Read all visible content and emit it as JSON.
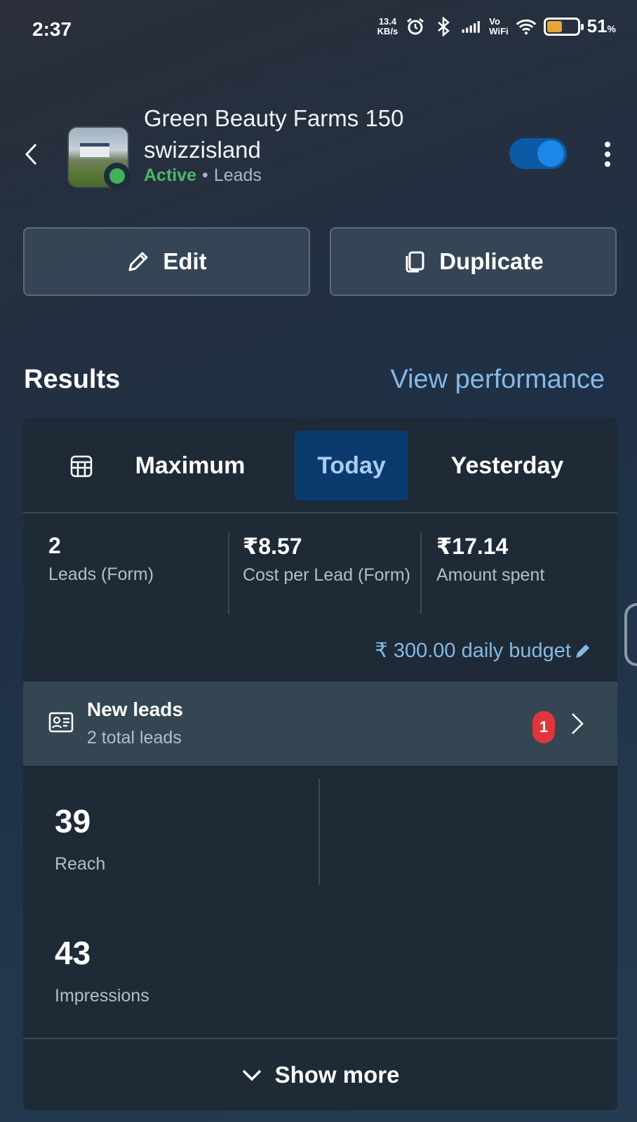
{
  "status_bar": {
    "time": "2:37",
    "net_speed_value": "13.4",
    "net_speed_unit": "KB/s",
    "vo": "Vo",
    "wifi_label": "WiFi",
    "battery_percent": "51",
    "battery_percent_sign": "%",
    "battery_level": 0.51,
    "icons": [
      "alarm-icon",
      "bluetooth-icon",
      "signal-icon",
      "wifi-icon",
      "battery-icon"
    ]
  },
  "header": {
    "title": "Green Beauty Farms 150 swizzisland",
    "status": "Active",
    "separator": "•",
    "objective": "Leads",
    "toggle_on": true,
    "status_color": "#44b05c"
  },
  "actions": {
    "edit_label": "Edit",
    "duplicate_label": "Duplicate"
  },
  "results": {
    "heading": "Results",
    "view_performance": "View performance",
    "tabs": [
      {
        "label": "Maximum",
        "selected": false
      },
      {
        "label": "Today",
        "selected": true
      },
      {
        "label": "Yesterday",
        "selected": false
      }
    ],
    "metrics": [
      {
        "value": "2",
        "label": "Leads (Form)"
      },
      {
        "value": "₹8.57",
        "label": "Cost per Lead (Form)"
      },
      {
        "value": "₹17.14",
        "label": "Amount spent"
      }
    ],
    "budget": "₹ 300.00 daily budget",
    "new_leads": {
      "title": "New leads",
      "subtitle": "2 total leads",
      "badge": "1"
    },
    "stats": [
      {
        "value": "39",
        "label": "Reach"
      },
      {
        "value": "43",
        "label": "Impressions"
      }
    ],
    "show_more": "Show more"
  },
  "colors": {
    "accent_link": "#84b9e6",
    "active_green": "#4cb866",
    "selected_tab_bg": "#0b3a6e",
    "badge_red": "#e0363b",
    "toggle_blue": "#1b87e6"
  }
}
